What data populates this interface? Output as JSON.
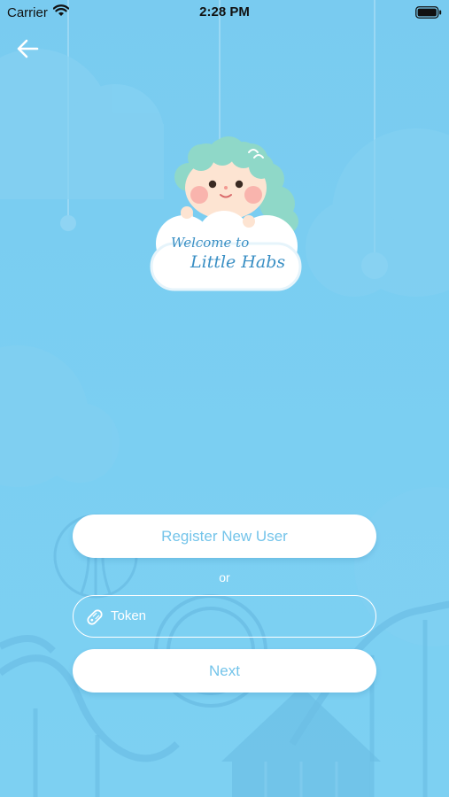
{
  "status_bar": {
    "carrier": "Carrier",
    "time": "2:28 PM"
  },
  "nav": {
    "back_icon": "arrow-left-icon"
  },
  "logo": {
    "line1": "Welcome to",
    "line2": "Little Habs"
  },
  "form": {
    "register_label": "Register New User",
    "or_label": "or",
    "token_placeholder": "Token",
    "token_value": "",
    "token_icon": "tag-icon",
    "next_label": "Next"
  },
  "colors": {
    "background": "#79cbf0",
    "accent_text": "#74c4ea",
    "logo_text": "#3a8fc4",
    "button_bg": "#ffffff"
  }
}
